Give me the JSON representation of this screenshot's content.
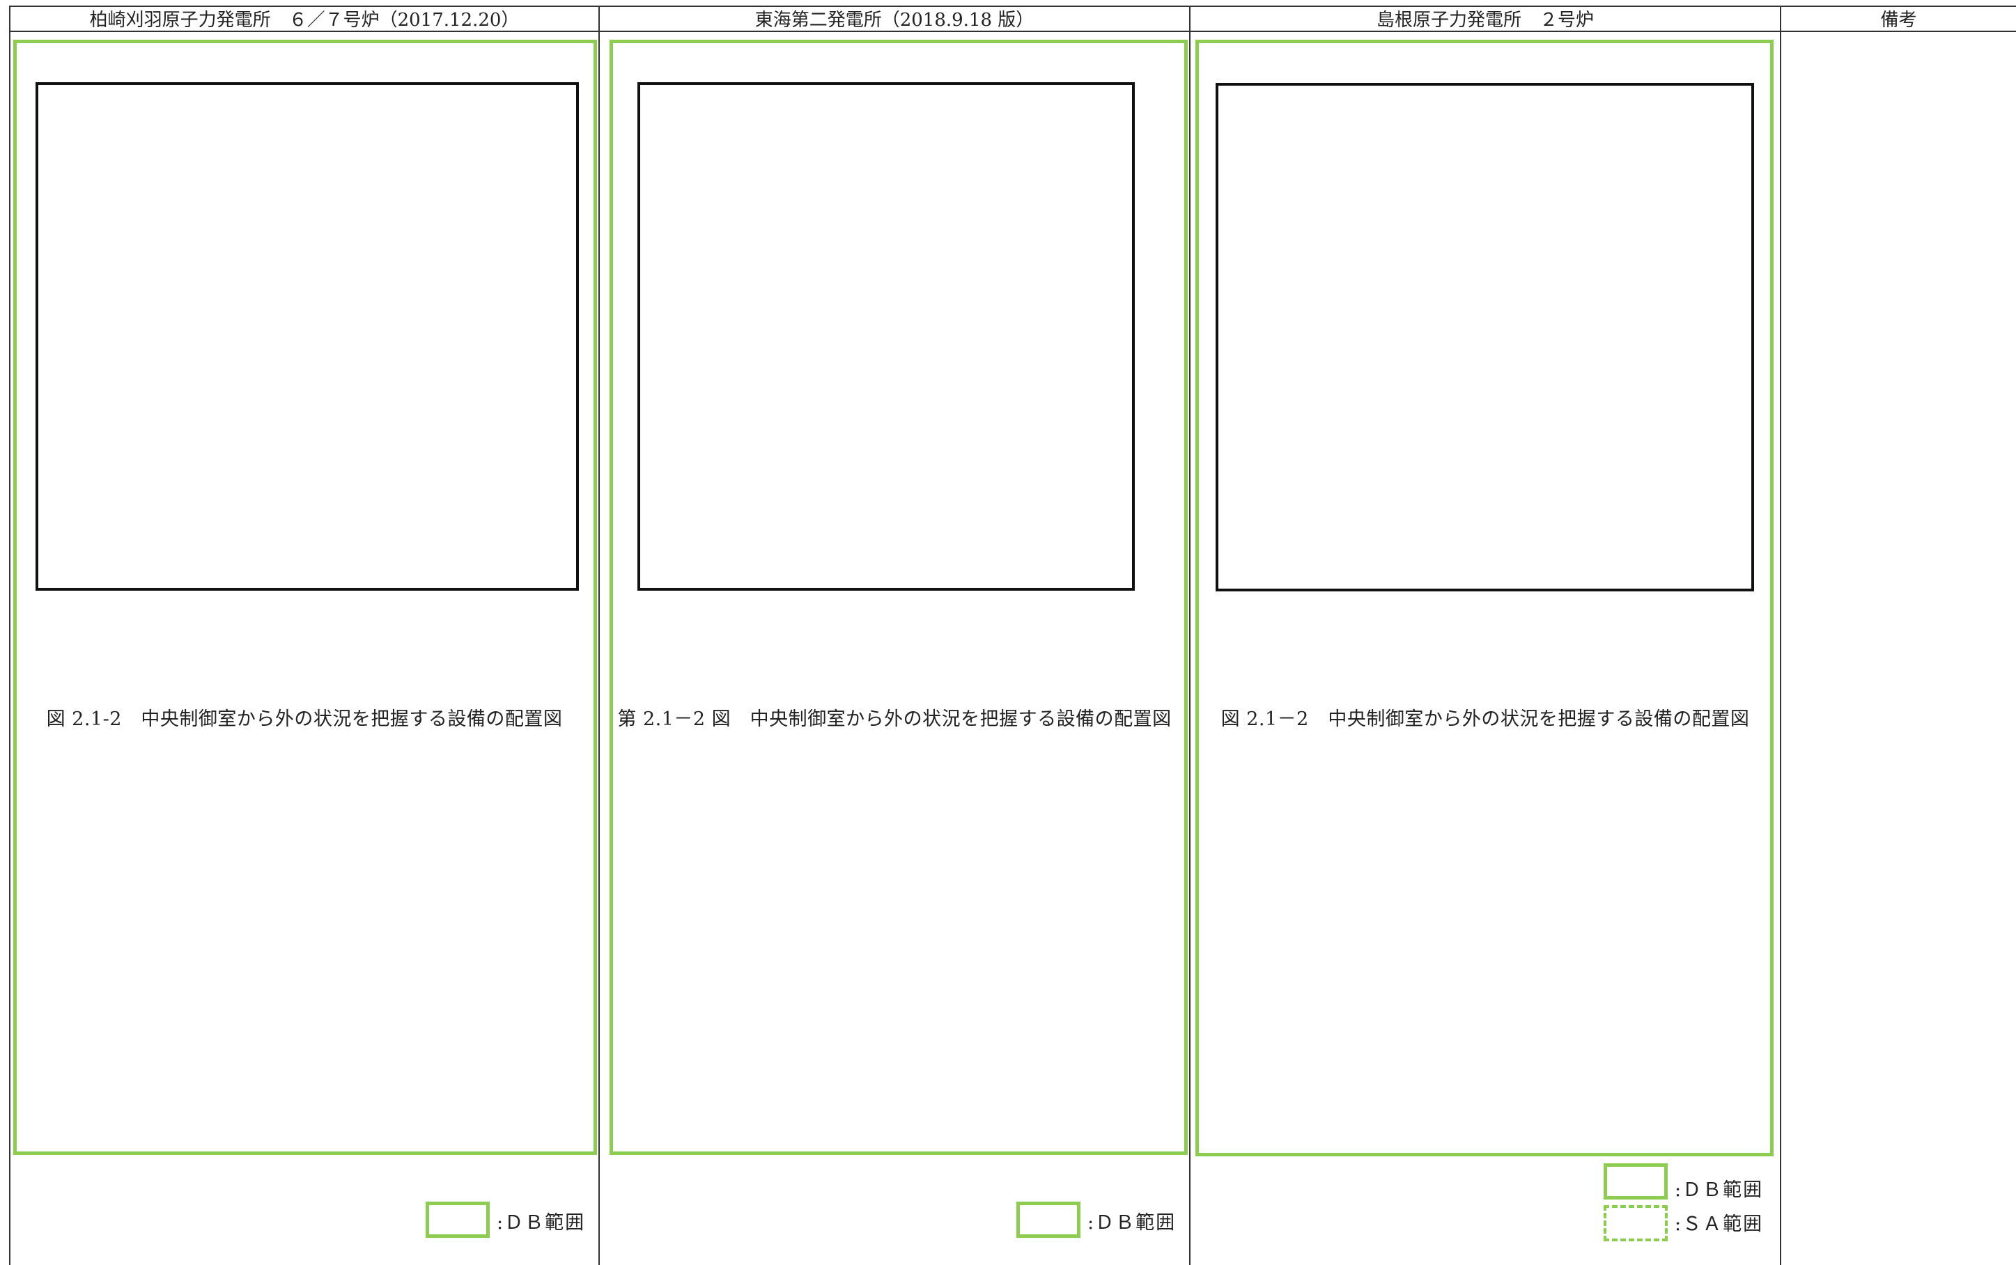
{
  "columns": [
    {
      "header": "柏崎刈羽原子力発電所　６／７号炉（2017.12.20）",
      "caption": "図 2.1-2　中央制御室から外の状況を把握する設備の配置図",
      "legend": [
        ":ＤＢ範囲"
      ]
    },
    {
      "header": "東海第二発電所（2018.9.18 版）",
      "caption": "第 2.1－2 図　中央制御室から外の状況を把握する設備の配置図",
      "legend": [
        ":ＤＢ範囲"
      ]
    },
    {
      "header": "島根原子力発電所　２号炉",
      "caption": "図 2.1－2　中央制御室から外の状況を把握する設備の配置図",
      "legend": [
        ":ＤＢ範囲",
        ":ＳＡ範囲"
      ]
    },
    {
      "header": "備考"
    }
  ],
  "colors": {
    "db_range": "#8ccc4f",
    "rule": "#333333"
  }
}
